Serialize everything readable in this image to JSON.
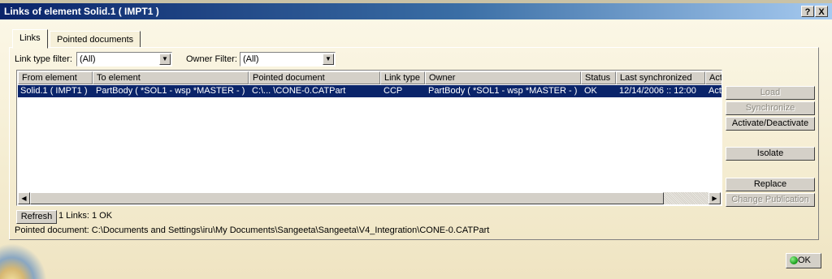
{
  "window": {
    "title": "Links of element Solid.1 ( IMPT1 )",
    "help_label": "?",
    "close_label": "X"
  },
  "tabs": [
    {
      "label": "Links",
      "active": true
    },
    {
      "label": "Pointed documents",
      "active": false
    }
  ],
  "filters": {
    "link_type_label": "Link type filter:",
    "link_type_value": "(All)",
    "owner_label": "Owner Filter:",
    "owner_value": "(All)"
  },
  "table": {
    "columns": [
      "From element",
      "To element",
      "Pointed document",
      "Link type",
      "Owner",
      "Status",
      "Last synchronized",
      "Act"
    ],
    "rows": [
      {
        "from": "Solid.1 ( IMPT1 )",
        "to": "PartBody ( *SOL1 - wsp *MASTER - )",
        "pointed": "C:\\... \\CONE-0.CATPart",
        "link_type": "CCP",
        "owner": "PartBody ( *SOL1 - wsp *MASTER - )",
        "status": "OK",
        "last_sync": "12/14/2006 :: 12:00",
        "act": "Acti",
        "selected": true
      }
    ]
  },
  "side_buttons": {
    "load": "Load",
    "synchronize": "Synchronize",
    "activate": "Activate/Deactivate",
    "isolate": "Isolate",
    "replace": "Replace",
    "change_publication": "Change Publication"
  },
  "refresh_label": "Refresh",
  "links_count": "1 Links: 1 OK",
  "pointed_document_path": "Pointed document: C:\\Documents and Settings\\iru\\My Documents\\Sangeeta\\Sangeeta\\V4_Integration\\CONE-0.CATPart",
  "ok_label": "OK",
  "colors": {
    "title_start": "#0a246a",
    "title_end": "#a6caf0",
    "selection": "#0a246a",
    "background": "#f5efd6"
  }
}
